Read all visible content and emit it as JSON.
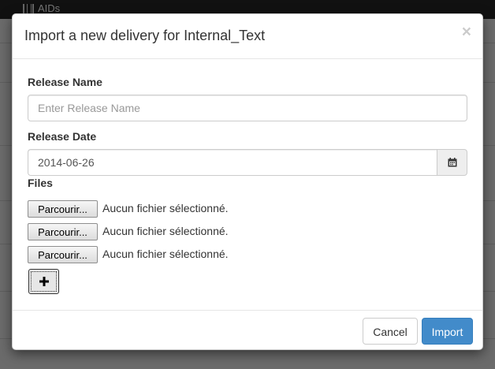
{
  "background": {
    "app_title": "AIDs"
  },
  "modal": {
    "title": "Import a new delivery for Internal_Text",
    "close_symbol": "×",
    "release_name": {
      "label": "Release Name",
      "value": "",
      "placeholder": "Enter Release Name"
    },
    "release_date": {
      "label": "Release Date",
      "value": "2014-06-26",
      "icon": "calendar-icon"
    },
    "files": {
      "label": "Files",
      "rows": [
        {
          "button_label": "Parcourir...",
          "status": "Aucun fichier sélectionné."
        },
        {
          "button_label": "Parcourir...",
          "status": "Aucun fichier sélectionné."
        },
        {
          "button_label": "Parcourir...",
          "status": "Aucun fichier sélectionné."
        }
      ],
      "add_icon": "plus-icon"
    },
    "footer": {
      "cancel_label": "Cancel",
      "import_label": "Import"
    }
  },
  "colors": {
    "primary": "#428bca",
    "backdrop": "#5a5a5a"
  }
}
